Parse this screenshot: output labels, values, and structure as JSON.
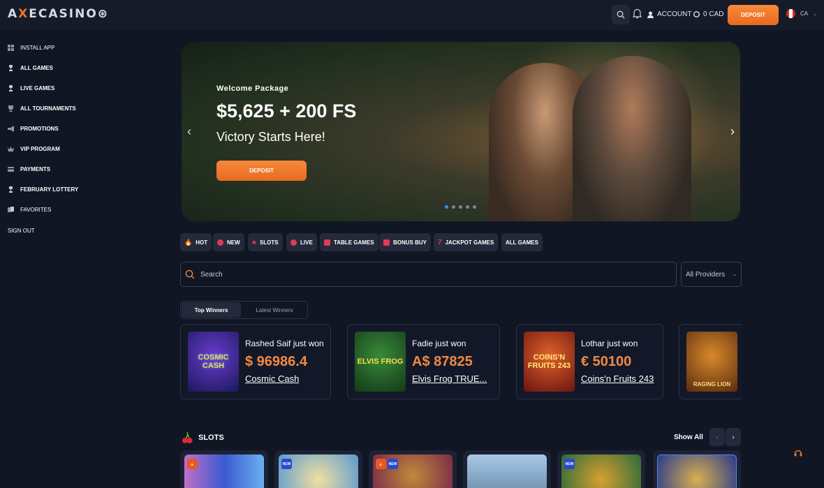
{
  "header": {
    "logo": {
      "part1": "A",
      "part2": "X",
      "part3": "ECASINO"
    },
    "account_label": "ACCOUNT",
    "balance": "0 CAD",
    "deposit_label": "DEPOSIT",
    "lang": "CA"
  },
  "sidebar": {
    "items": [
      {
        "label": "INSTALL APP",
        "icon": "grid-icon"
      },
      {
        "label": "ALL GAMES",
        "icon": "joystick-icon"
      },
      {
        "label": "LIVE GAMES",
        "icon": "joystick-icon"
      },
      {
        "label": "ALL TOURNAMENTS",
        "icon": "trophy-icon"
      },
      {
        "label": "PROMOTIONS",
        "icon": "megaphone-icon"
      },
      {
        "label": "VIP PROGRAM",
        "icon": "crown-icon"
      },
      {
        "label": "PAYMENTS",
        "icon": "card-icon"
      },
      {
        "label": "FEBRUARY LOTTERY",
        "icon": "ticket-icon"
      },
      {
        "label": "FAVORITES",
        "icon": "cards-icon"
      }
    ],
    "signout": "SIGN OUT"
  },
  "hero": {
    "subtitle": "Welcome Package",
    "title": "$5,625 + 200 FS",
    "tagline": "Victory Starts Here!",
    "deposit_label": "DEPOSIT",
    "prev": "‹",
    "next": "›",
    "slides": 5,
    "active_slide": 1
  },
  "categories": [
    {
      "label": "HOT",
      "color": "#e4503a"
    },
    {
      "label": "NEW",
      "color": "#e23b55"
    },
    {
      "label": "SLOTS",
      "color": "#e23b55"
    },
    {
      "label": "LIVE",
      "color": "#e23b55"
    },
    {
      "label": "TABLE GAMES",
      "color": "#e23b55"
    },
    {
      "label": "BONUS BUY",
      "color": "#e23b55"
    },
    {
      "label": "JACKPOT GAMES",
      "color": "#e23b55"
    },
    {
      "label": "ALL GAMES",
      "color": ""
    }
  ],
  "search": {
    "placeholder": "Search",
    "providers": "All Providers"
  },
  "winner_tabs": {
    "active": "Top Winners",
    "inactive": "Latest Winners"
  },
  "winners": [
    {
      "name": "Rashed Saif just won",
      "amount": "$ 96986.4",
      "game": "Cosmic Cash",
      "thumb_label": "COSMIC CASH"
    },
    {
      "name": "Fadie just won",
      "amount": "A$ 87825",
      "game": "Elvis Frog TRUE...",
      "thumb_label": "ELVIS FROG"
    },
    {
      "name": "Lothar just won",
      "amount": "€ 50100",
      "game": "Coins'n Fruits 243",
      "thumb_label": "COINS'N FRUITS 243"
    },
    {
      "name": "",
      "amount": "",
      "game": "",
      "thumb_label": "RAGING LION"
    }
  ],
  "slots": {
    "title": "SLOTS",
    "show_all": "Show All",
    "prev": "‹",
    "next": "›",
    "badges": [
      "hot",
      "new",
      "hot-new",
      "",
      "new",
      ""
    ]
  }
}
